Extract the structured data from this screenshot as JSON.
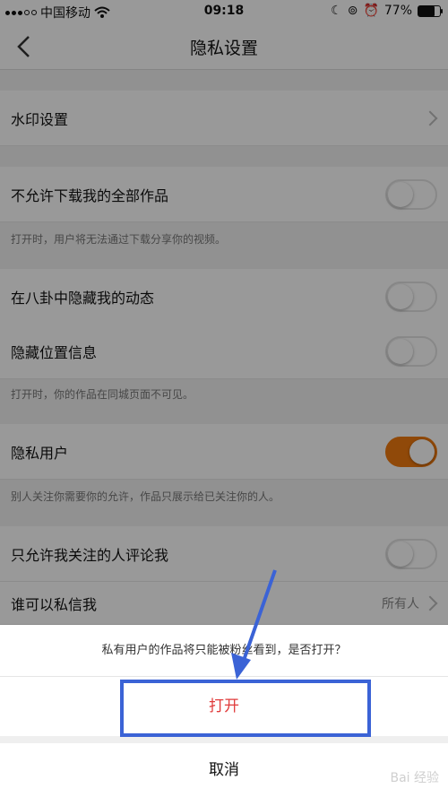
{
  "status": {
    "carrier": "中国移动",
    "time": "09:18",
    "battery_text": "77%",
    "battery_level": 0.77
  },
  "nav": {
    "title": "隐私设置",
    "back_icon": "chevron-left-icon"
  },
  "rows": {
    "watermark_setting": "水印设置",
    "no_download": "不允许下载我的全部作品",
    "no_download_note": "打开时，用户将无法通过下载分享你的视频。",
    "hide_in_gossip": "在八卦中隐藏我的动态",
    "hide_location": "隐藏位置信息",
    "hide_location_note": "打开时，你的作品在同城页面不可见。",
    "private_user": "隐私用户",
    "private_user_note": "别人关注你需要你的允许，作品只展示给已关注你的人。",
    "comment_only_following": "只允许我关注的人评论我",
    "who_can_message": "谁可以私信我",
    "who_can_message_value": "所有人"
  },
  "toggles": {
    "no_download": false,
    "hide_in_gossip": false,
    "hide_location": false,
    "private_user": true,
    "comment_only_following": false
  },
  "sheet": {
    "message": "私有用户的作品将只能被粉丝看到，是否打开？",
    "open_label": "打开",
    "cancel_label": "取消"
  },
  "colors": {
    "accent": "#f07a0f",
    "destructive": "#e03b3b",
    "annotation": "#3b63d6"
  },
  "watermark_text": "Bai 经验"
}
